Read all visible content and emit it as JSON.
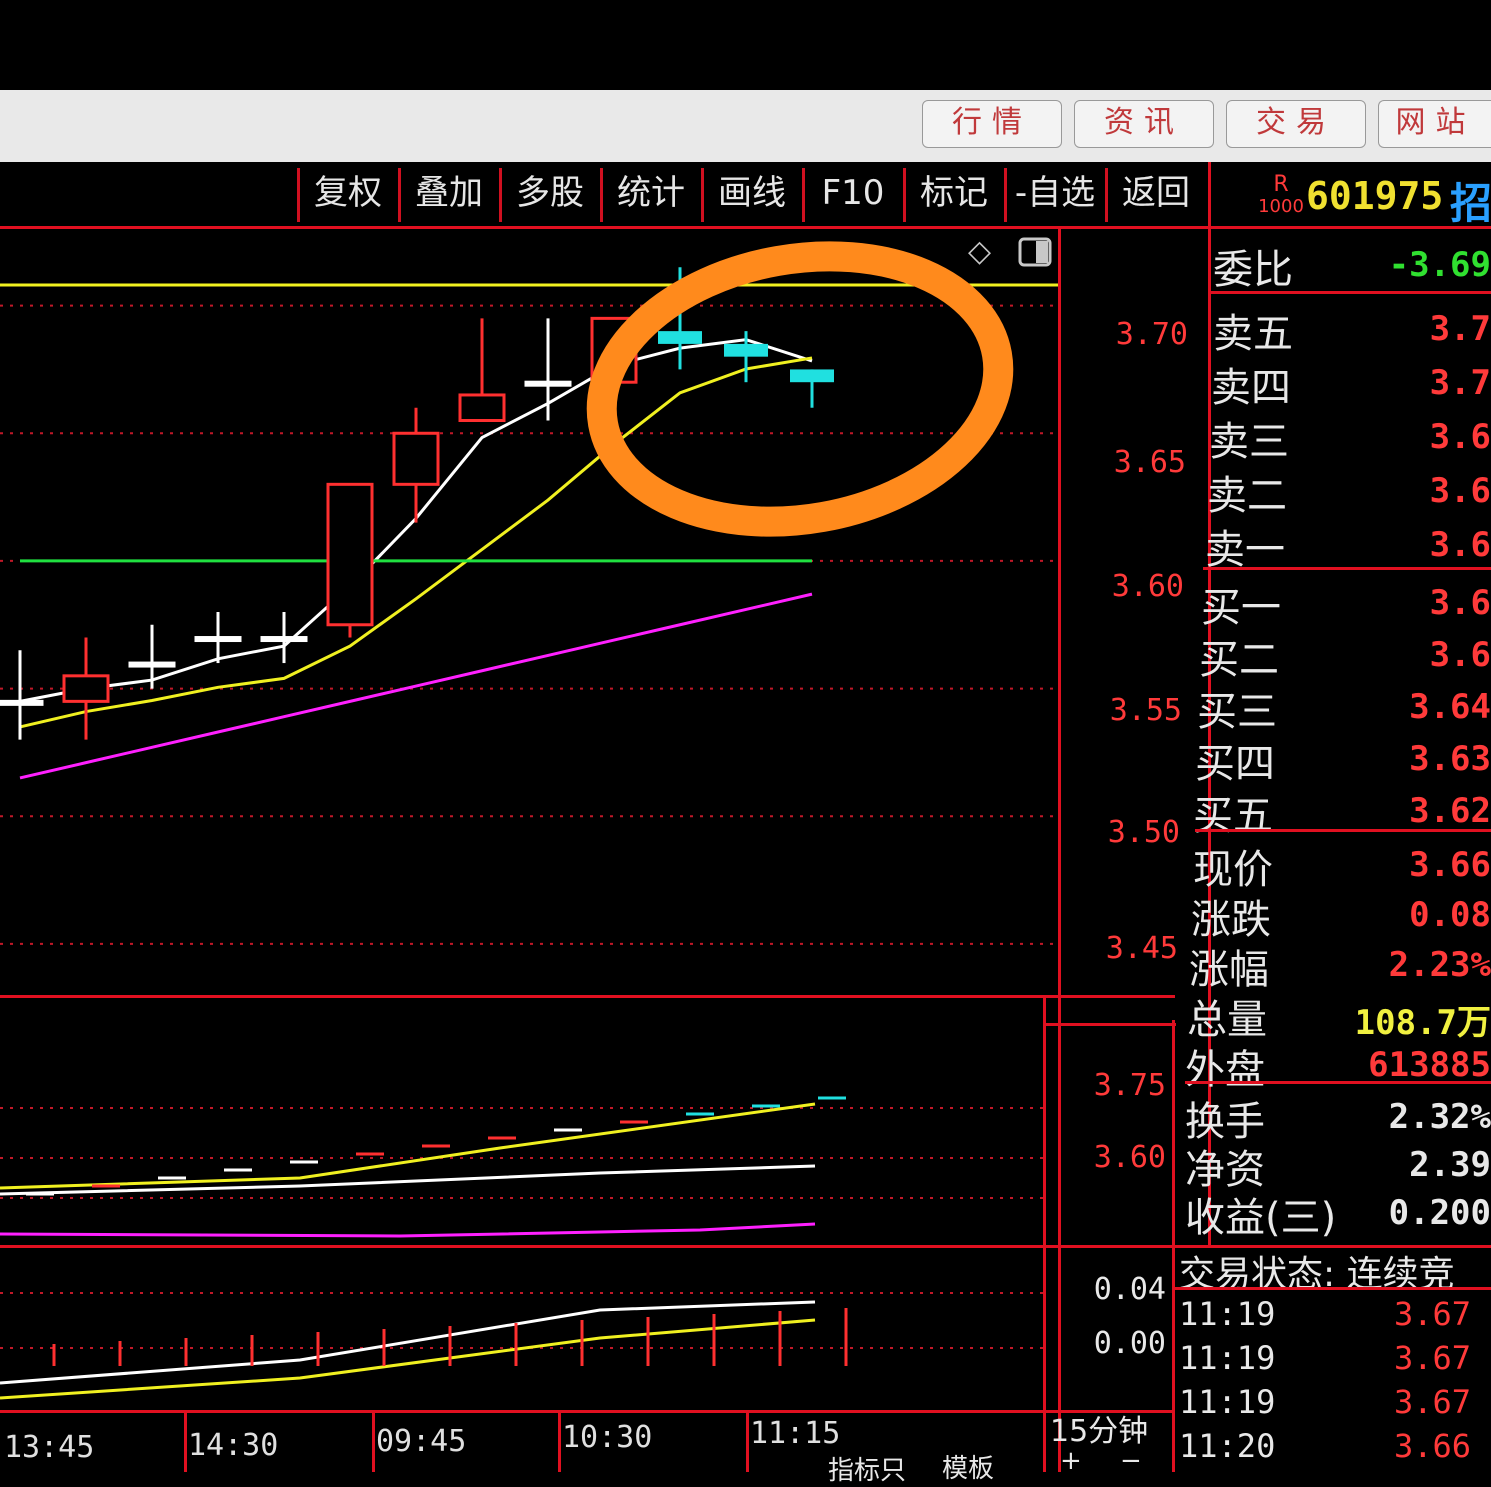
{
  "top_tabs": [
    "行情",
    "资讯",
    "交易",
    "网站"
  ],
  "toolbar": [
    "复权",
    "叠加",
    "多股",
    "统计",
    "画线",
    "F10",
    "标记",
    "-自选",
    "返回"
  ],
  "stock": {
    "badge_top": "R",
    "badge_bottom": "1000",
    "code": "601975",
    "name_partial": "招"
  },
  "price_axis": [
    "3.70",
    "3.65",
    "3.60",
    "3.55",
    "3.50",
    "3.45"
  ],
  "vol_axis": [
    "3.75",
    "3.60"
  ],
  "ind_axis": [
    "0.04",
    "0.00"
  ],
  "time_axis": [
    "13:45",
    "14:30",
    "09:45",
    "10:30",
    "11:15"
  ],
  "period": "15分钟",
  "bottom_tabs": [
    "指标只",
    "模板",
    "+",
    "−"
  ],
  "quote": {
    "weibi_label": "委比",
    "weibi_value": "-3.69",
    "asks": [
      {
        "label": "卖五",
        "price": "3.7"
      },
      {
        "label": "卖四",
        "price": "3.7"
      },
      {
        "label": "卖三",
        "price": "3.6"
      },
      {
        "label": "卖二",
        "price": "3.6"
      },
      {
        "label": "卖一",
        "price": "3.6"
      }
    ],
    "bids": [
      {
        "label": "买一",
        "price": "3.6"
      },
      {
        "label": "买二",
        "price": "3.6"
      },
      {
        "label": "买三",
        "price": "3.64"
      },
      {
        "label": "买四",
        "price": "3.63"
      },
      {
        "label": "买五",
        "price": "3.62"
      }
    ],
    "stats": [
      {
        "label": "现价",
        "value": "3.66",
        "color": "#ff3a3a"
      },
      {
        "label": "涨跌",
        "value": "0.08",
        "color": "#ff3a3a"
      },
      {
        "label": "涨幅",
        "value": "2.23%",
        "color": "#ff3a3a"
      },
      {
        "label": "总量",
        "value": "108.7万",
        "color": "#f0f040"
      },
      {
        "label": "外盘",
        "value": "613885",
        "color": "#ff3a3a"
      }
    ],
    "stats2": [
      {
        "label": "换手",
        "value": "2.32%"
      },
      {
        "label": "净资",
        "value": "2.39"
      },
      {
        "label": "收益(三)",
        "value": "0.200"
      }
    ],
    "status_label": "交易状态: 连续竞",
    "ticks": [
      {
        "time": "11:19",
        "price": "3.67"
      },
      {
        "time": "11:19",
        "price": "3.67"
      },
      {
        "time": "11:19",
        "price": "3.67"
      },
      {
        "time": "11:20",
        "price": "3.66"
      }
    ]
  },
  "colors": {
    "up": "#ff3030",
    "down": "#20e0e0",
    "ma5": "#ffffff",
    "ma10": "#f0f020",
    "ma20": "#20e040",
    "ma60": "#ff20ff",
    "annotation": "#ff8a1c"
  },
  "chart_data": {
    "type": "candlestick",
    "ylim": [
      3.43,
      3.73
    ],
    "candles": [
      {
        "o": 3.545,
        "c": 3.545,
        "h": 3.565,
        "l": 3.53,
        "dir": "flat"
      },
      {
        "o": 3.545,
        "c": 3.555,
        "h": 3.57,
        "l": 3.53,
        "dir": "up"
      },
      {
        "o": 3.56,
        "c": 3.56,
        "h": 3.575,
        "l": 3.55,
        "dir": "flat"
      },
      {
        "o": 3.57,
        "c": 3.57,
        "h": 3.58,
        "l": 3.56,
        "dir": "flat"
      },
      {
        "o": 3.57,
        "c": 3.57,
        "h": 3.58,
        "l": 3.56,
        "dir": "flat"
      },
      {
        "o": 3.575,
        "c": 3.63,
        "h": 3.63,
        "l": 3.57,
        "dir": "up"
      },
      {
        "o": 3.63,
        "c": 3.65,
        "h": 3.66,
        "l": 3.615,
        "dir": "up"
      },
      {
        "o": 3.655,
        "c": 3.665,
        "h": 3.695,
        "l": 3.655,
        "dir": "up"
      },
      {
        "o": 3.67,
        "c": 3.67,
        "h": 3.695,
        "l": 3.655,
        "dir": "flat"
      },
      {
        "o": 3.67,
        "c": 3.695,
        "h": 3.695,
        "l": 3.67,
        "dir": "up"
      },
      {
        "o": 3.69,
        "c": 3.685,
        "h": 3.715,
        "l": 3.675,
        "dir": "down"
      },
      {
        "o": 3.685,
        "c": 3.68,
        "h": 3.69,
        "l": 3.67,
        "dir": "down"
      },
      {
        "o": 3.675,
        "c": 3.67,
        "h": 3.675,
        "l": 3.66,
        "dir": "down"
      }
    ]
  }
}
